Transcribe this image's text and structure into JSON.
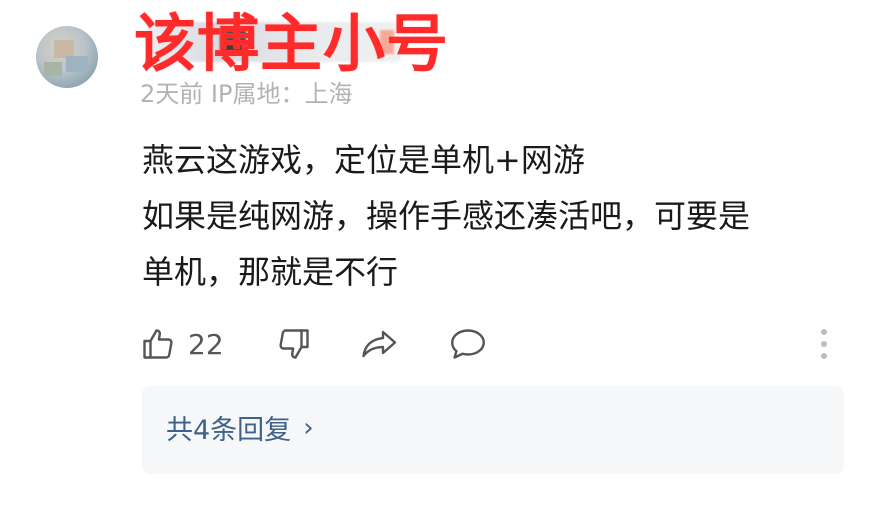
{
  "overlay": {
    "title": "该博主小号"
  },
  "user": {
    "meta": "2天前 IP属地：上海"
  },
  "comment": {
    "lines": [
      "燕云这游戏，定位是单机+网游",
      "如果是纯网游，操作手感还凑活吧，可要是",
      "单机，那就是不行"
    ]
  },
  "actions": {
    "like_count": "22",
    "icons": [
      "thumbs-up-icon",
      "thumbs-down-icon",
      "share-icon",
      "comment-icon",
      "more-vertical-icon"
    ]
  },
  "replies": {
    "label": "共4条回复",
    "chevron": "›"
  },
  "colors": {
    "overlay_red": "#ff2a2a",
    "link_blue": "#3f6289",
    "meta_gray": "#b3b3b3"
  }
}
